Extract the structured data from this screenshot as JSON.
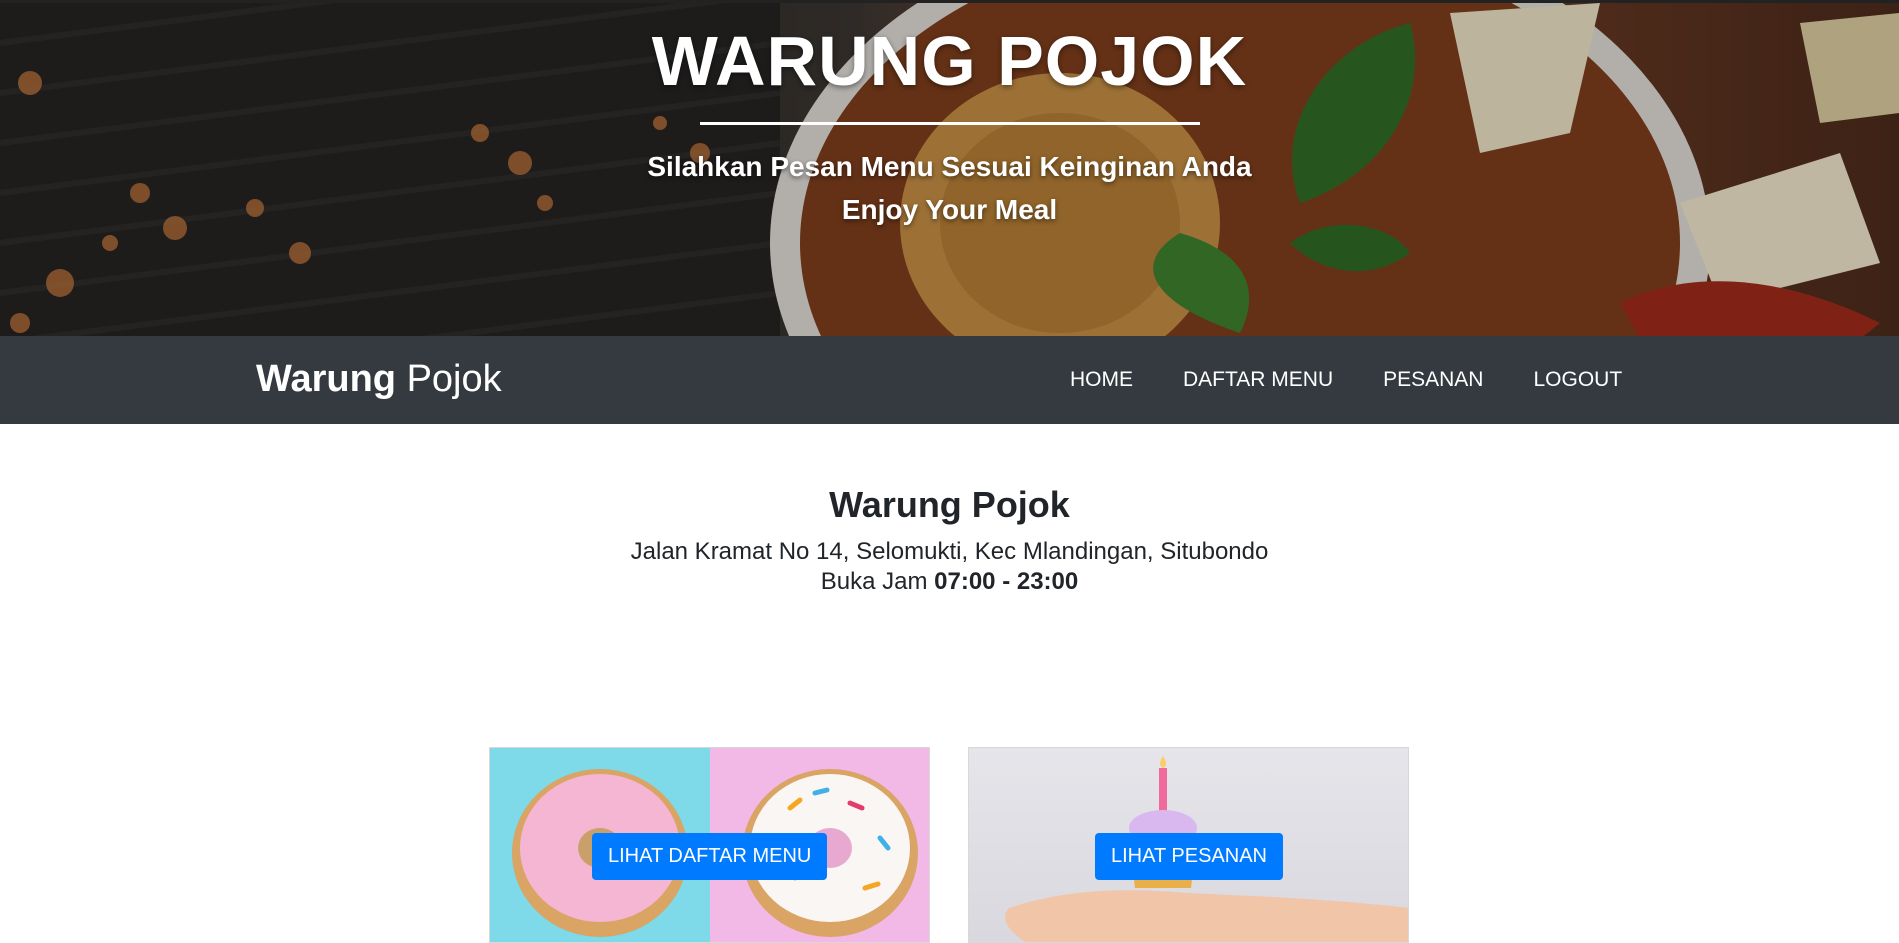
{
  "hero": {
    "title": "WARUNG POJOK",
    "subtitle_line1": "Silahkan Pesan Menu Sesuai Keinginan Anda",
    "subtitle_line2": "Enjoy Your Meal"
  },
  "navbar": {
    "brand_bold": "Warung",
    "brand_light": "Pojok",
    "links": [
      {
        "label": "HOME"
      },
      {
        "label": "DAFTAR MENU"
      },
      {
        "label": "PESANAN"
      },
      {
        "label": "LOGOUT"
      }
    ],
    "background_color": "#343a40"
  },
  "info": {
    "name": "Warung Pojok",
    "address": "Jalan Kramat No 14, Selomukti, Kec Mlandingan, Situbondo",
    "hours_label": "Buka Jam",
    "hours_value": "07:00 - 23:00"
  },
  "cards": [
    {
      "button_label": "LIHAT DAFTAR MENU",
      "image": "donuts-image"
    },
    {
      "button_label": "LIHAT PESANAN",
      "image": "cupcake-on-hand-image"
    }
  ],
  "colors": {
    "primary_button": "#007bff",
    "text": "#212529"
  }
}
